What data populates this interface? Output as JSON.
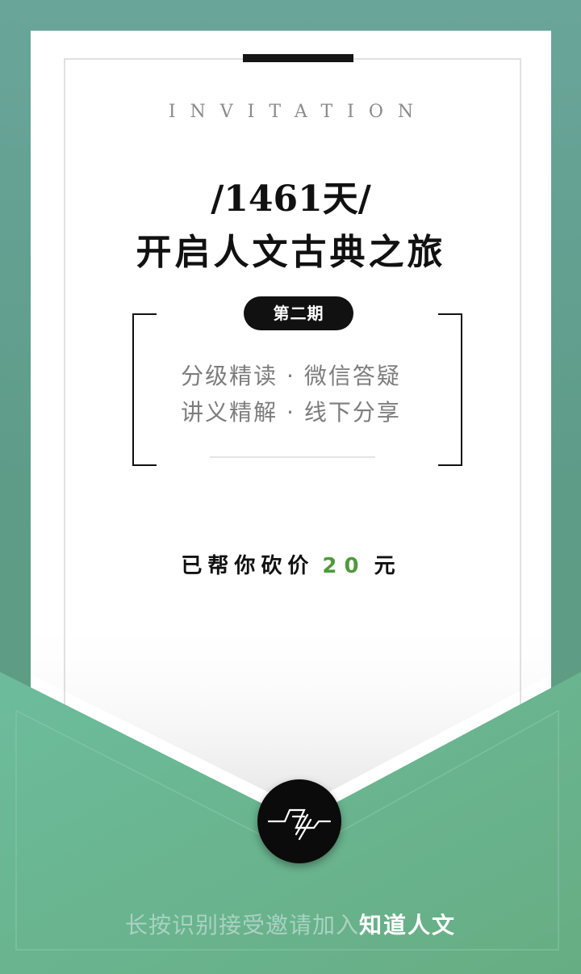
{
  "invitation": {
    "heading": "INVITATION",
    "days": "/1461天/",
    "subtitle": "开启人文古典之旅",
    "issue": "第二期",
    "features": [
      "分级精读 · 微信答疑",
      "讲义精解 · 线下分享"
    ],
    "bargain_prefix": "已帮你砍价",
    "bargain_amount": "20",
    "bargain_suffix": "元"
  },
  "footer": {
    "prompt": "长按识别接受邀请加入",
    "brand": "知道人文"
  },
  "colors": {
    "background": "#5f9d87",
    "envelope": "#67b494",
    "accent_green": "#4e9a3c",
    "pill": "#111111"
  },
  "icons": {
    "logo": "zhidao-renwen-logo-icon"
  }
}
